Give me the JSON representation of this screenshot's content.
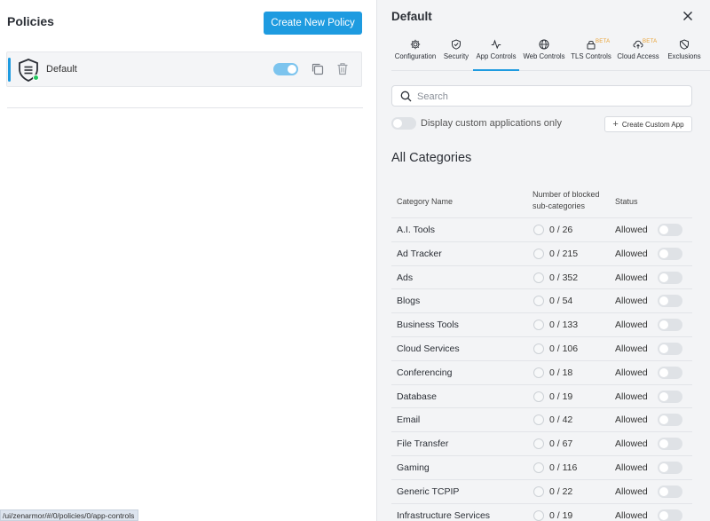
{
  "left": {
    "title": "Policies",
    "create_button": "Create New Policy",
    "policy": {
      "name": "Default",
      "enabled": true,
      "status_color": "#22c55e"
    }
  },
  "status_url": "/ui/zenarmor/#/0/policies/0/app-controls",
  "right": {
    "title": "Default",
    "tabs": [
      {
        "label": "Configuration",
        "icon": "gear-icon",
        "active": false
      },
      {
        "label": "Security",
        "icon": "shield-icon",
        "active": false
      },
      {
        "label": "App Controls",
        "icon": "activity-icon",
        "active": true
      },
      {
        "label": "Web Controls",
        "icon": "globe-icon",
        "active": false
      },
      {
        "label": "TLS Controls",
        "icon": "lock-icon",
        "active": false,
        "badge": "BETA"
      },
      {
        "label": "Cloud Access",
        "icon": "cloud-icon",
        "active": false,
        "badge": "BETA"
      },
      {
        "label": "Exclusions",
        "icon": "shield-off-icon",
        "active": false
      }
    ],
    "search_placeholder": "Search",
    "custom_only_label": "Display custom applications only",
    "create_custom_app": "Create Custom App",
    "section_title": "All Categories",
    "table": {
      "headers": {
        "name": "Category Name",
        "number": "Number of blocked sub-categories",
        "status": "Status"
      },
      "rows": [
        {
          "name": "A.I. Tools",
          "count": "0 / 26",
          "status": "Allowed"
        },
        {
          "name": "Ad Tracker",
          "count": "0 / 215",
          "status": "Allowed"
        },
        {
          "name": "Ads",
          "count": "0 / 352",
          "status": "Allowed"
        },
        {
          "name": "Blogs",
          "count": "0 / 54",
          "status": "Allowed"
        },
        {
          "name": "Business Tools",
          "count": "0 / 133",
          "status": "Allowed"
        },
        {
          "name": "Cloud Services",
          "count": "0 / 106",
          "status": "Allowed"
        },
        {
          "name": "Conferencing",
          "count": "0 / 18",
          "status": "Allowed"
        },
        {
          "name": "Database",
          "count": "0 / 19",
          "status": "Allowed"
        },
        {
          "name": "Email",
          "count": "0 / 42",
          "status": "Allowed"
        },
        {
          "name": "File Transfer",
          "count": "0 / 67",
          "status": "Allowed"
        },
        {
          "name": "Gaming",
          "count": "0 / 116",
          "status": "Allowed"
        },
        {
          "name": "Generic TCPIP",
          "count": "0 / 22",
          "status": "Allowed"
        },
        {
          "name": "Infrastructure Services",
          "count": "0 / 19",
          "status": "Allowed"
        }
      ]
    }
  },
  "colors": {
    "accent": "#1e9be0",
    "beta": "#e8a030",
    "online": "#22c55e"
  }
}
